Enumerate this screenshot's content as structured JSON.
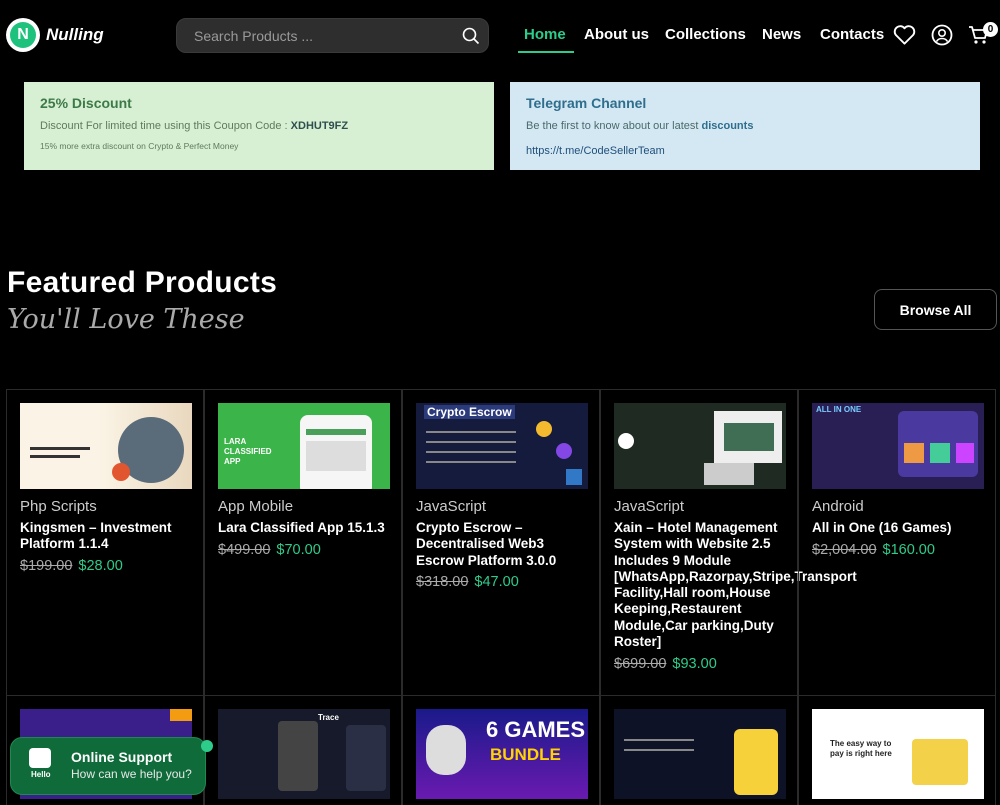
{
  "brand": {
    "name": "Nulling",
    "logo_letter": "N",
    "accent": "#2ecc8a"
  },
  "search": {
    "placeholder": "Search Products ..."
  },
  "nav": [
    {
      "label": "Home",
      "active": true
    },
    {
      "label": "About us"
    },
    {
      "label": "Collections"
    },
    {
      "label": "News"
    },
    {
      "label": "Contacts"
    }
  ],
  "header_icons": [
    "heart-icon",
    "user-icon",
    "cart-icon"
  ],
  "cart": {
    "count": "0"
  },
  "promos": {
    "discount": {
      "title": "25% Discount",
      "line_prefix": "Discount For limited time using this Coupon Code : ",
      "code": "XDHUT9FZ",
      "small": "15% more extra discount on Crypto & Perfect Money"
    },
    "telegram": {
      "title": "Telegram Channel",
      "line_prefix": "Be the first to know about our latest ",
      "highlight": "discounts",
      "link": "https://t.me/CodeSellerTeam"
    }
  },
  "featured": {
    "title": "Featured Products",
    "subtitle": "You'll Love These",
    "browse_label": "Browse All"
  },
  "products": [
    {
      "category": "Php Scripts",
      "name": "Kingsmen – Investment Platform 1.1.4",
      "old_price": "$199.00",
      "price": "$28.00"
    },
    {
      "category": "App Mobile",
      "name": "Lara Classified App 15.1.3",
      "old_price": "$499.00",
      "price": "$70.00"
    },
    {
      "category": "JavaScript",
      "name": "Crypto Escrow – Decentralised Web3 Escrow Platform 3.0.0",
      "old_price": "$318.00",
      "price": "$47.00"
    },
    {
      "category": "JavaScript",
      "name": "Xain – Hotel Management System with Website 2.5 Includes 9 Module [WhatsApp,Razorpay,Stripe,Transport Facility,Hall room,House Keeping,Restaurent Module,Car parking,Duty Roster]",
      "old_price": "$699.00",
      "price": "$93.00"
    },
    {
      "category": "Android",
      "name": "All in One (16 Games)",
      "old_price": "$2,004.00",
      "price": "$160.00"
    }
  ],
  "thumb_texts": {
    "lara": "LARA CLASSIFIED APP",
    "escrow": "Crypto Escrow",
    "games": "ALL IN ONE",
    "six_games": "6 GAMES",
    "bundle": "BUNDLE",
    "trace": "Trace",
    "easy": "The easy way to pay is right here"
  },
  "support": {
    "title": "Online Support",
    "subtitle": "How can we help you?",
    "hello": "Hello"
  }
}
